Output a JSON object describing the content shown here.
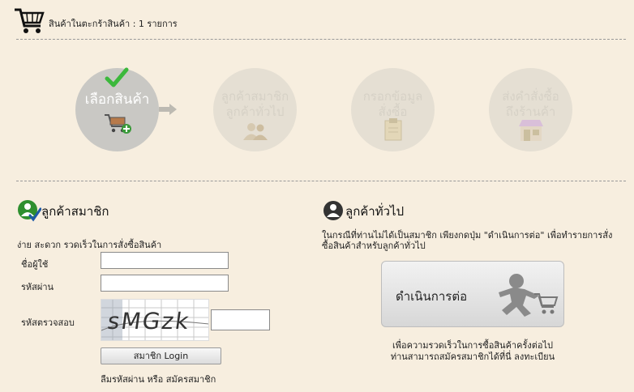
{
  "header": {
    "cart_icon": "shopping-cart-icon",
    "cart_text": "สินค้าในตะกร้าสินค้า : 1 รายการ"
  },
  "steps": [
    {
      "label_line1": "เลือกสินค้า",
      "label_line2": "",
      "icon": "cart-add-icon",
      "active": true
    },
    {
      "label_line1": "ลูกค้าสมาชิก",
      "label_line2": "ลูกค้าทั่วไป",
      "icon": "customers-icon",
      "active": false
    },
    {
      "label_line1": "กรอกข้อมูล",
      "label_line2": "สั่งซื้อ",
      "icon": "clipboard-icon",
      "active": false
    },
    {
      "label_line1": "ส่งคำสั่งซื้อ",
      "label_line2": "ถึงร้านค้า",
      "icon": "store-icon",
      "active": false
    }
  ],
  "member": {
    "title": "ลูกค้าสมาชิก",
    "subtitle": "ง่าย สะดวก รวดเร็วในการสั่งซื้อสินค้า",
    "username_label": "ชื่อผู้ใช้",
    "username_value": "",
    "password_label": "รหัสผ่าน",
    "password_value": "",
    "captcha_label": "รหัสตรวจสอบ",
    "captcha_text": "sMGzk",
    "captcha_value": "",
    "login_button": "สมาชิก Login",
    "forgot_text": "ลืมรหัสผ่าน หรือ สมัครสมาชิก"
  },
  "guest": {
    "title": "ลูกค้าทั่วไป",
    "desc_line1": "ในกรณีที่ท่านไม่ได้เป็นสมาชิก เพียงกดปุ่ม \"ดำเนินการต่อ\" เพื่อทำรายการสั่ง",
    "desc_line2": "ซื้อสินค้าสำหรับลูกค้าทั่วไป",
    "continue_button": "ดำเนินการต่อ",
    "note_line1": "เพื่อความรวดเร็วในการซื้อสินค้าครั้งต่อไป",
    "note_line2": "ท่านสามารถสมัครสมาชิกได้ที่นี่  ลงทะเบียน"
  },
  "colors": {
    "background": "#f7eedf",
    "active_step": "#c9c8c4",
    "inactive_step": "#e5dfd3",
    "check_green": "#3cb83c"
  }
}
